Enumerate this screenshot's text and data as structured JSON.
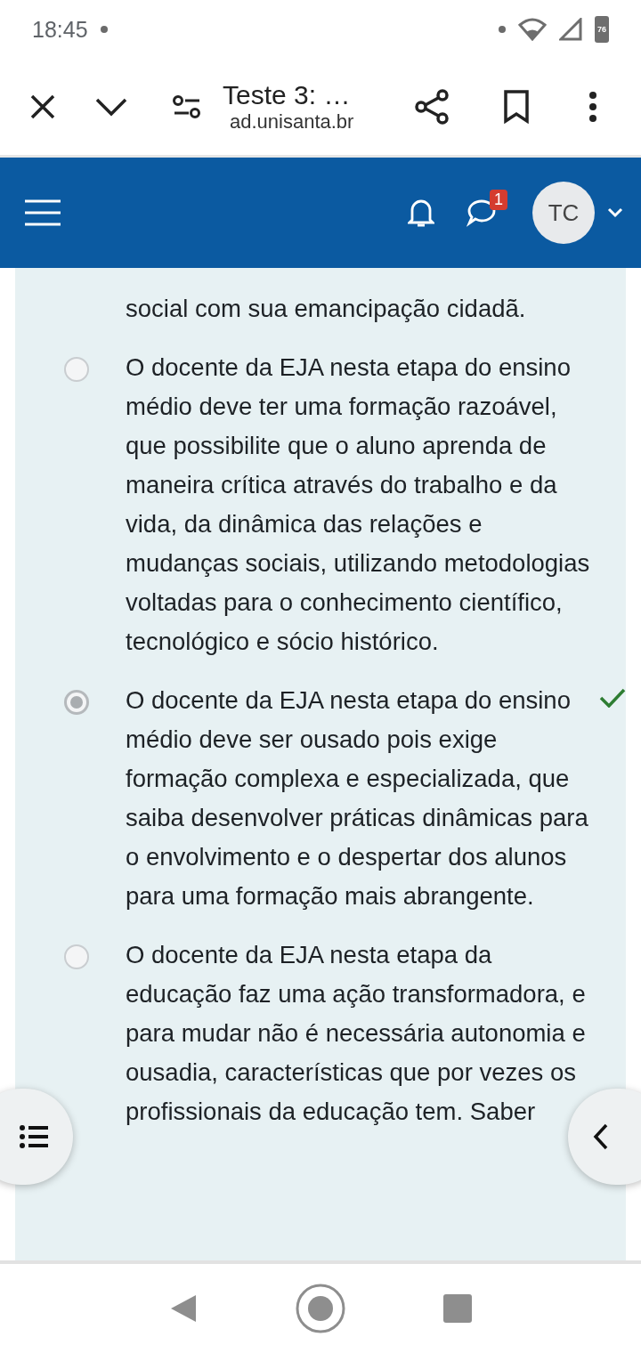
{
  "status_bar": {
    "time": "18:45",
    "battery": "76"
  },
  "browser_bar": {
    "title": "Teste 3: …",
    "url": "ad.unisanta.br"
  },
  "header": {
    "messages_badge": "1",
    "avatar": "TC"
  },
  "previous_option_end": "social com sua emancipação cidadã.",
  "options": [
    {
      "text": "O docente da EJA nesta etapa do ensino médio deve ter uma formação razoável, que possibilite que o aluno aprenda de maneira crítica através do trabalho e da vida, da dinâmica das relações e mudanças sociais, utilizando metodologias voltadas para o conhecimento científico, tecnológico e sócio histórico.",
      "selected": false,
      "correct": false
    },
    {
      "text": "O docente da EJA nesta etapa do ensino médio deve ser ousado pois exige formação complexa e especializada, que saiba desenvolver práticas dinâmicas para o envolvimento e o despertar dos alunos para uma formação mais abrangente.",
      "selected": true,
      "correct": true
    },
    {
      "text": "O docente da EJA nesta etapa da educação faz uma ação transformadora, e para mudar não é necessária autonomia e ousadia, características que por vezes os profissionais da educação tem. Saber",
      "selected": false,
      "correct": false
    }
  ]
}
